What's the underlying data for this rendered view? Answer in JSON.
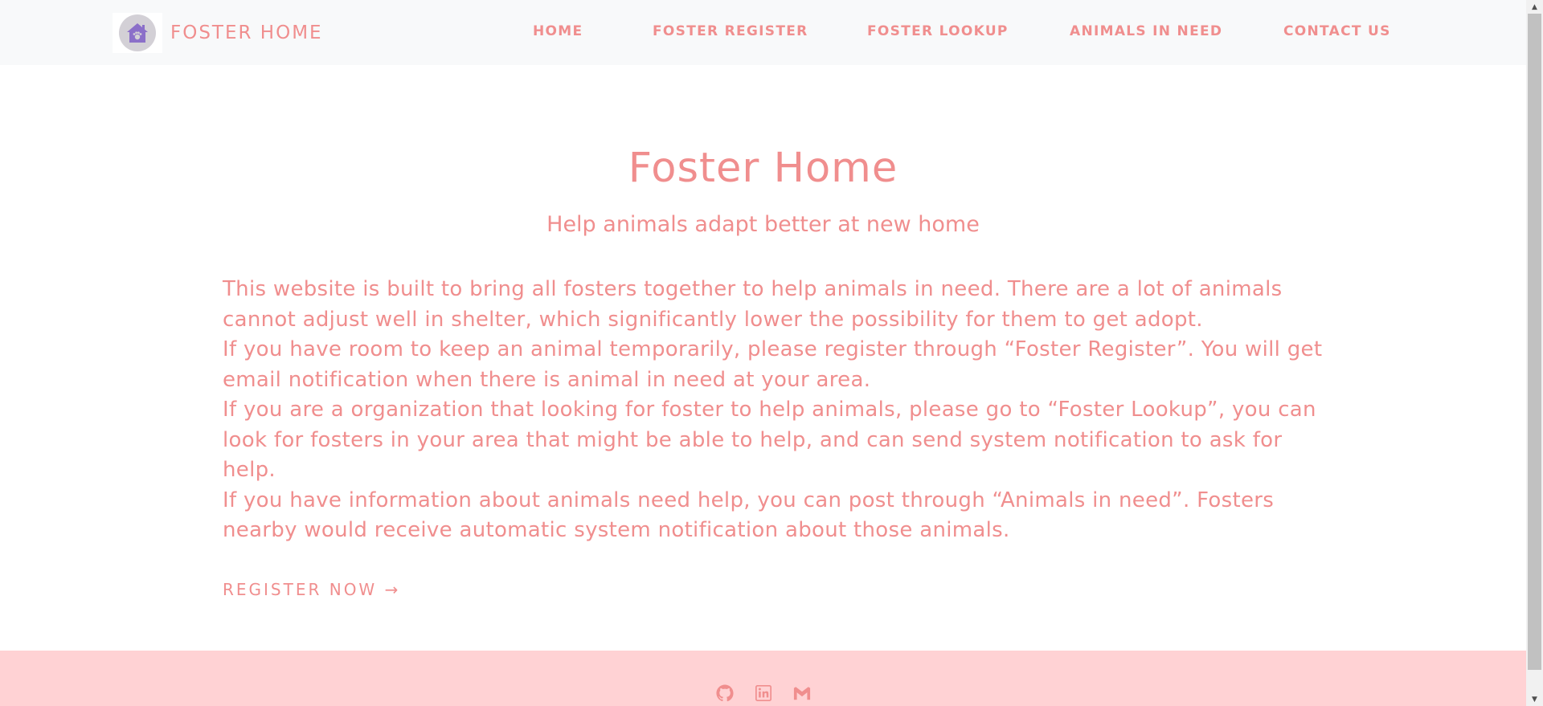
{
  "navbar": {
    "brand_name": "FOSTER HOME",
    "links": [
      {
        "label": "HOME"
      },
      {
        "label": "FOSTER REGISTER"
      },
      {
        "label": "FOSTER LOOKUP"
      },
      {
        "label": "ANIMALS IN NEED"
      },
      {
        "label": "CONTACT US"
      }
    ]
  },
  "hero": {
    "title": "Foster Home",
    "subtitle": "Help animals adapt better at new home"
  },
  "content": {
    "paragraphs": [
      "This website is built to bring all fosters together to help animals in need. There are a lot of animals cannot adjust well in shelter, which significantly lower the possibility for them to get adopt.",
      "If you have room to keep an animal temporarily, please register through “Foster Register”. You will get email notification when there is animal in need at your area.",
      "If you are a organization that looking for foster to help animals, please go to “Foster Lookup”, you can look for fosters in your area that might be able to help, and can send system notification to ask for help.",
      "If you have information about animals need help, you can post through “Animals in need”. Fosters nearby would receive automatic system notification about those animals."
    ],
    "cta_label": "REGISTER NOW →"
  },
  "footer": {
    "icons": [
      "github-icon",
      "linkedin-icon",
      "gmail-icon"
    ]
  },
  "colors": {
    "accent": "#f08e8e",
    "navbar_bg": "#f8f9fa",
    "footer_bg": "#ffd2d4",
    "logo_purple": "#8b6fc9"
  }
}
